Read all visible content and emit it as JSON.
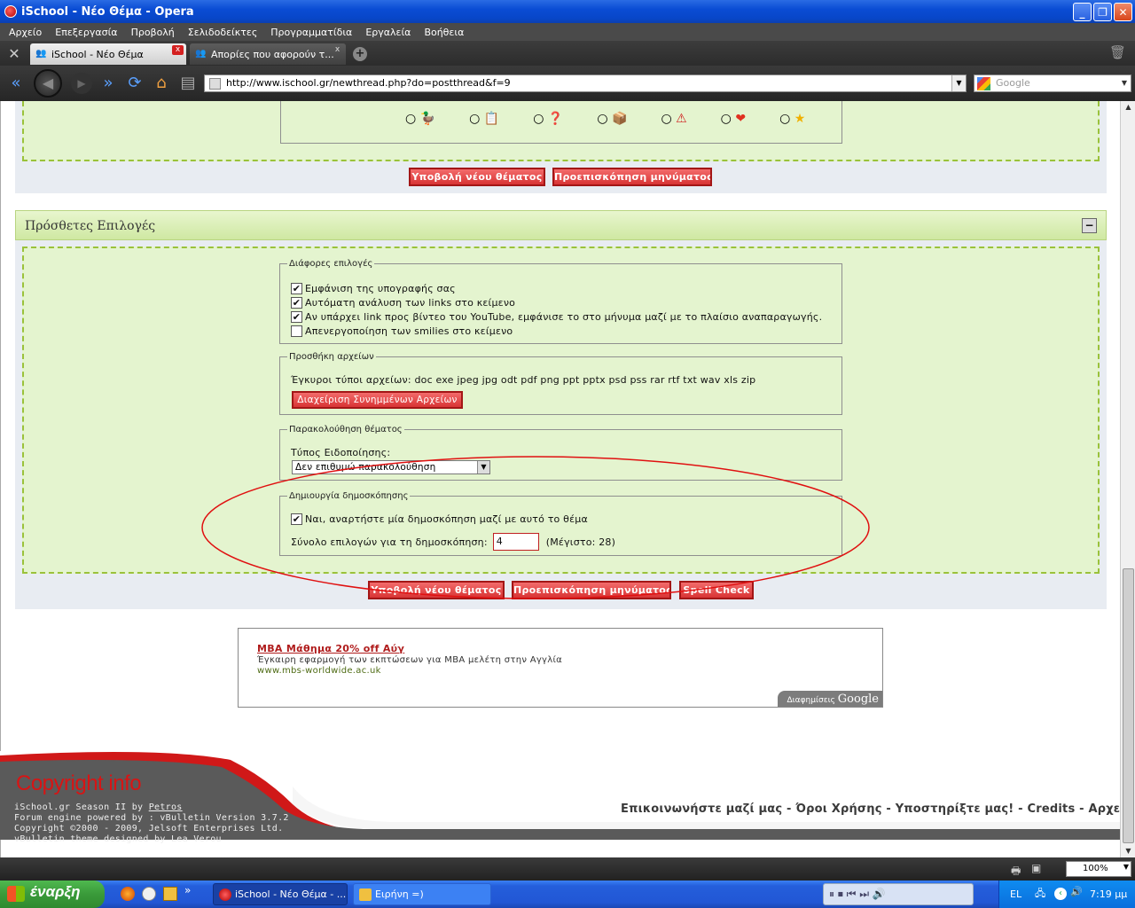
{
  "window": {
    "title": "iSchool - Νέο Θέμα - Opera"
  },
  "menu": [
    "Αρχείο",
    "Επεξεργασία",
    "Προβολή",
    "Σελιδοδείκτες",
    "Προγραμματίδια",
    "Εργαλεία",
    "Βοήθεια"
  ],
  "tabs": [
    {
      "label": "iSchool - Νέο Θέμα"
    },
    {
      "label": "Απορίες που αφορούν τ..."
    }
  ],
  "address": {
    "url": "http://www.ischool.gr/newthread.php?do=postthread&f=9"
  },
  "search": {
    "placeholder": "Google"
  },
  "page": {
    "top_buttons": {
      "submit": "Υποβολή νέου θέματος",
      "preview": "Προεπισκόπηση μηνύματος"
    },
    "additional_options_title": "Πρόσθετες Επιλογές",
    "misc_options": {
      "legend": "Διάφορες επιλογές",
      "items": [
        {
          "label": "Εμφάνιση της υπογραφής σας",
          "checked": true
        },
        {
          "label": "Αυτόματη ανάλυση των links στο κείμενο",
          "checked": true
        },
        {
          "label": "Αν υπάρχει link προς βίντεο του YouTube, εμφάνισε το στο μήνυμα μαζί με το πλαίσιο αναπαραγωγής.",
          "checked": true
        },
        {
          "label": "Απενεργοποίηση των smilies στο κείμενο",
          "checked": false
        }
      ]
    },
    "attachments": {
      "legend": "Προσθήκη αρχείων",
      "valid_types": "Έγκυροι τύποι αρχείων: doc exe jpeg jpg odt pdf png ppt pptx psd pss rar rtf txt wav xls zip",
      "manage_button": "Διαχείριση Συνημμένων Αρχείων"
    },
    "subscription": {
      "legend": "Παρακολούθηση θέματος",
      "type_label": "Τύπος Ειδοποίησης:",
      "selected": "Δεν επιθυμώ παρακολούθηση"
    },
    "poll": {
      "legend": "Δημιουργία δημοσκόπησης",
      "post_poll_label": "Ναι, αναρτήστε μία δημοσκόπηση μαζί με αυτό το θέμα",
      "post_poll_checked": true,
      "options_label": "Σύνολο επιλογών για τη δημοσκόπηση:",
      "options_value": "4",
      "max_label": "(Μέγιστο: 28)"
    },
    "bottom_buttons": {
      "submit": "Υποβολή νέου θέματος",
      "preview": "Προεπισκόπηση μηνύματος",
      "spell": "Spell Check"
    },
    "ad": {
      "title": "MBA Μάθημα 20% off Αύγ",
      "text": "Έγκαιρη εφαρμογή των εκπτώσεων για MBA μελέτη στην Αγγλία",
      "url": "www.mbs-worldwide.ac.uk",
      "badge_prefix": "Διαφημίσεις",
      "badge_brand": "Google"
    }
  },
  "footer": {
    "title": "Copyright info",
    "line1_prefix": "iSchool.gr Season II by",
    "line1_author": "Petros",
    "line2": "Forum engine powered by : vBulletin Version 3.7.2",
    "line3": "Copyright ©2000 - 2009, Jelsoft Enterprises Ltd.",
    "line4": "vBulletin theme designed by Lea Verou",
    "links": [
      "Επικοινωνήστε μαζί μας",
      "Όροι Χρήσης",
      "Υποστηρίξτε μας!",
      "Credits",
      "Αρχείο"
    ]
  },
  "statusbar": {
    "zoom": "100%"
  },
  "taskbar": {
    "start": "έναρξη",
    "tasks": [
      {
        "label": "iSchool - Νέο Θέμα - ..."
      },
      {
        "label": "Ειρήνη =)"
      }
    ],
    "lang": "EL",
    "clock": "7:19 μμ"
  },
  "colors": {
    "panel_green": "#e4f4cf",
    "dashed_border": "#9ac23a",
    "button_red": "#d83434",
    "annotation_ellipse": "#e01010"
  },
  "icons": [
    "tools-icon",
    "back-icon",
    "forward-icon",
    "fast-forward-icon",
    "reload-icon",
    "home-icon",
    "wand-icon",
    "page-icon",
    "google-icon",
    "collapse-icon",
    "trash-icon"
  ]
}
